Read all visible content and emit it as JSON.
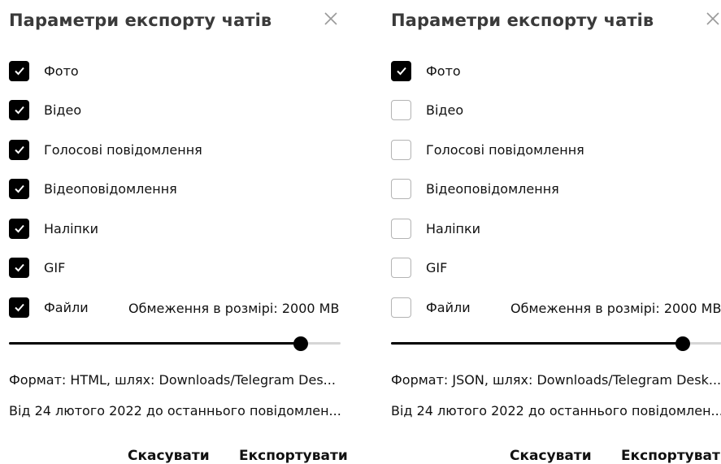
{
  "dialogs": [
    {
      "title": "Параметри експорту чатів",
      "options": [
        {
          "label": "Фото",
          "checked": true
        },
        {
          "label": "Відео",
          "checked": true
        },
        {
          "label": "Голосові повідомлення",
          "checked": true
        },
        {
          "label": "Відеоповідомлення",
          "checked": true
        },
        {
          "label": "Наліпки",
          "checked": true
        },
        {
          "label": "GIF",
          "checked": true
        },
        {
          "label": "Файли",
          "checked": true
        }
      ],
      "size_limit": "Обмеження в розмірі: 2000 MB",
      "slider_fraction": 0.88,
      "format_path": "Формат: HTML, шлях: Downloads/Telegram Des...",
      "date_range": "Від 24 лютого 2022 до останнього повідомлен...",
      "cancel_label": "Скасувати",
      "export_label": "Експортувати"
    },
    {
      "title": "Параметри експорту чатів",
      "options": [
        {
          "label": "Фото",
          "checked": true
        },
        {
          "label": "Відео",
          "checked": false
        },
        {
          "label": "Голосові повідомлення",
          "checked": false
        },
        {
          "label": "Відеоповідомлення",
          "checked": false
        },
        {
          "label": "Наліпки",
          "checked": false
        },
        {
          "label": "GIF",
          "checked": false
        },
        {
          "label": "Файли",
          "checked": false
        }
      ],
      "size_limit": "Обмеження в розмірі: 2000 MB",
      "slider_fraction": 0.88,
      "format_path": "Формат: JSON, шлях: Downloads/Telegram Desk...",
      "date_range": "Від 24 лютого 2022 до останнього повідомлен...",
      "cancel_label": "Скасувати",
      "export_label": "Експортувати"
    }
  ],
  "icons": {
    "close": "close-icon",
    "check": "checkmark-icon"
  },
  "colors": {
    "accent": "#000000",
    "track": "#d6d6d6",
    "title": "#3a3a3a",
    "close": "#9a9a9a"
  }
}
